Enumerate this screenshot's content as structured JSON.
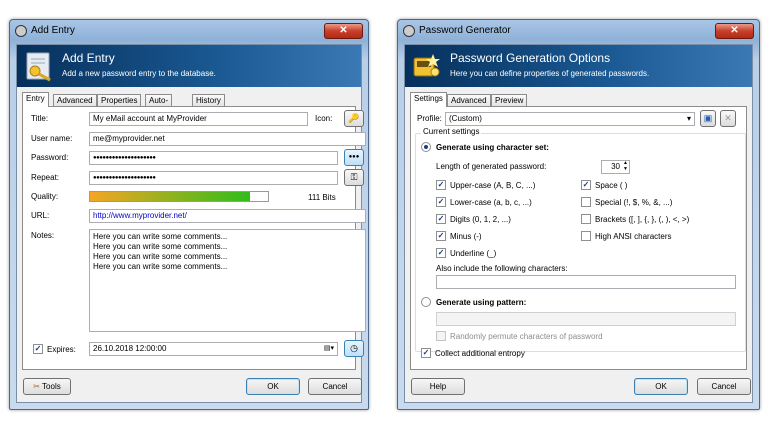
{
  "add_entry": {
    "window_title": "Add Entry",
    "banner_title": "Add Entry",
    "banner_subtitle": "Add a new password entry to the database.",
    "tabs": [
      "Entry",
      "Advanced",
      "Properties",
      "Auto-Type",
      "History"
    ],
    "title_label": "Title:",
    "title_value": "My eMail account at MyProvider",
    "icon_label": "Icon:",
    "username_label": "User name:",
    "username_value": "me@myprovider.net",
    "password_label": "Password:",
    "password_value": "●●●●●●●●●●●●●●●●●●●●",
    "show_password_label": "●●●",
    "repeat_label": "Repeat:",
    "repeat_value": "●●●●●●●●●●●●●●●●●●●●",
    "quality_label": "Quality:",
    "quality_fraction": 0.9,
    "quality_bits": "111 Bits",
    "url_label": "URL:",
    "url_value": "http://www.myprovider.net/",
    "notes_label": "Notes:",
    "notes_lines": [
      "Here you can write some comments...",
      "Here you can write some comments...",
      "Here you can write some comments...",
      "Here you can write some comments..."
    ],
    "expires_label": "Expires:",
    "expires_checked": true,
    "expires_value": "26.10.2018 12:00:00",
    "tools_label": "Tools",
    "ok_label": "OK",
    "cancel_label": "Cancel"
  },
  "password_generator": {
    "window_title": "Password Generator",
    "banner_title": "Password Generation Options",
    "banner_subtitle": "Here you can define properties of generated passwords.",
    "tabs": [
      "Settings",
      "Advanced",
      "Preview"
    ],
    "profile_label": "Profile:",
    "profile_value": "(Custom)",
    "current_settings_label": "Current settings",
    "charset_radio_label": "Generate using character set:",
    "length_label": "Length of generated password:",
    "length_value": "30",
    "options_left": [
      {
        "label": "Upper-case (A, B, C, ...)",
        "checked": true
      },
      {
        "label": "Lower-case (a, b, c, ...)",
        "checked": true
      },
      {
        "label": "Digits (0, 1, 2, ...)",
        "checked": true
      },
      {
        "label": "Minus (-)",
        "checked": true
      },
      {
        "label": "Underline (_)",
        "checked": true
      }
    ],
    "options_right": [
      {
        "label": "Space ( )",
        "checked": true
      },
      {
        "label": "Special (!, $, %, &, ...)",
        "checked": false
      },
      {
        "label": "Brackets ([, ], {, }, (, ), <, >)",
        "checked": false
      },
      {
        "label": "High ANSI characters",
        "checked": false
      }
    ],
    "also_include_label": "Also include the following characters:",
    "pattern_radio_label": "Generate using pattern:",
    "permute_label": "Randomly permute characters of password",
    "entropy_label": "Collect additional entropy",
    "entropy_checked": true,
    "help_label": "Help",
    "ok_label": "OK",
    "cancel_label": "Cancel"
  },
  "colors": {
    "banner_dark": "#06305c",
    "quality_start": "#f5a623",
    "quality_end": "#2ebd1a"
  }
}
